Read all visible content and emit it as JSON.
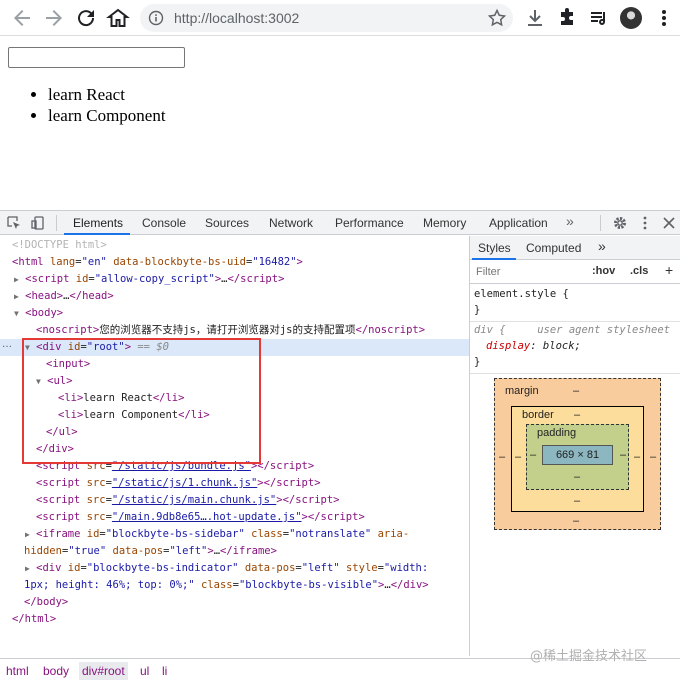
{
  "browser": {
    "url": "http://localhost:3002",
    "back_icon": "back-arrow-icon",
    "forward_icon": "forward-arrow-icon",
    "reload_icon": "reload-icon",
    "home_icon": "home-icon"
  },
  "page": {
    "input_value": "",
    "list_items": [
      "learn React",
      "learn Component"
    ]
  },
  "devtools": {
    "tabs": [
      "Elements",
      "Console",
      "Sources",
      "Network",
      "Performance",
      "Memory",
      "Application"
    ],
    "active_tab": "Elements",
    "more_tabs": "»",
    "settings_icon": "gear-icon",
    "menu_icon": "kebab-menu-icon",
    "close_icon": "close-icon",
    "dom": {
      "doctype": "<!DOCTYPE html>",
      "html_open": "<html",
      "html_attr1_name": "lang",
      "html_attr1_val": "\"en\"",
      "html_attr2_name": "data-blockbyte-bs-uid",
      "html_attr2_val": "\"16482\"",
      "script_allow_id": "\"allow-copy_script\"",
      "ellipsis": "…",
      "noscript_text": "您的浏览器不支持js，请打开浏览器对js的支持配置项",
      "root_id": "\"root\"",
      "selected_marker": "== $0",
      "li1": "learn React",
      "li2": "learn Component",
      "script_src1": "\"/static/js/bundle.js\"",
      "script_src2": "\"/static/js/1.chunk.js\"",
      "script_src3": "\"/static/js/main.chunk.js\"",
      "script_src4": "\"/main.9db8e65….hot-update.js\"",
      "iframe_id": "\"blockbyte-bs-sidebar\"",
      "iframe_class": "\"notranslate\"",
      "iframe_aria": "aria-",
      "iframe_hidden": "hidden",
      "iframe_hidden_val": "\"true\"",
      "iframe_datapos": "\"left\"",
      "ind_id": "\"blockbyte-bs-indicator\"",
      "ind_datapos": "\"left\"",
      "ind_style_part1": "\"width:",
      "ind_style_part2": "1px; height: 46%; top: 0%;\"",
      "ind_class": "\"blockbyte-bs-visible\""
    },
    "styles": {
      "tabs": [
        "Styles",
        "Computed"
      ],
      "more": "»",
      "filter_placeholder": "Filter",
      "hov": ":hov",
      "cls": ".cls",
      "plus": "+",
      "element_style": "element.style {",
      "close_brace": "}",
      "rule_selector": "div {",
      "ua_label": "user agent stylesheet",
      "prop_name": "display",
      "prop_value": "block;",
      "box_model": {
        "margin_label": "margin",
        "border_label": "border",
        "padding_label": "padding",
        "content_size": "669 × 81",
        "dash": "–"
      }
    },
    "breadcrumb": [
      "html",
      "body",
      "div#root",
      "ul",
      "li"
    ]
  },
  "watermark": "@稀土掘金技术社区"
}
